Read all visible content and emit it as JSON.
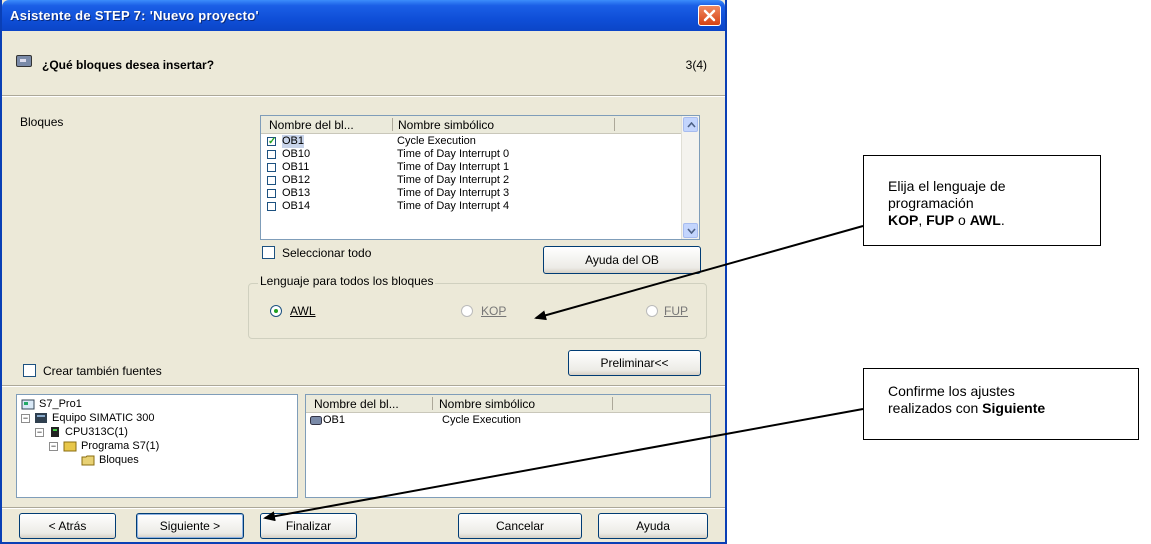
{
  "window": {
    "title": "Asistente de STEP 7: 'Nuevo proyecto'",
    "question": "¿Qué bloques desea insertar?",
    "step": "3(4)"
  },
  "blocks": {
    "label": "Bloques",
    "columns": [
      "Nombre del bl...",
      "Nombre simbólico"
    ],
    "rows": [
      {
        "name": "OB1",
        "symbol": "Cycle Execution",
        "checked": true
      },
      {
        "name": "OB10",
        "symbol": "Time of Day Interrupt 0",
        "checked": false
      },
      {
        "name": "OB11",
        "symbol": "Time of Day Interrupt 1",
        "checked": false
      },
      {
        "name": "OB12",
        "symbol": "Time of Day Interrupt 2",
        "checked": false
      },
      {
        "name": "OB13",
        "symbol": "Time of Day Interrupt 3",
        "checked": false
      },
      {
        "name": "OB14",
        "symbol": "Time of Day Interrupt 4",
        "checked": false
      }
    ],
    "select_all": "Seleccionar todo",
    "help_ob": "Ayuda del OB"
  },
  "language": {
    "group_label": "Lenguaje para todos los bloques",
    "options": [
      "AWL",
      "KOP",
      "FUP"
    ],
    "selected": "AWL"
  },
  "create_sources": "Crear también fuentes",
  "preview_button": "Preliminar<<",
  "preview": {
    "tree": [
      {
        "label": "S7_Pro1"
      },
      {
        "label": "Equipo SIMATIC 300"
      },
      {
        "label": "CPU313C(1)"
      },
      {
        "label": "Programa S7(1)"
      },
      {
        "label": "Bloques"
      }
    ],
    "columns": [
      "Nombre del bl...",
      "Nombre simbólico"
    ],
    "rows": [
      {
        "name": "OB1",
        "symbol": "Cycle Execution"
      }
    ]
  },
  "buttons": {
    "back": "< Atrás",
    "next": "Siguiente >",
    "finish": "Finalizar",
    "cancel": "Cancelar",
    "help": "Ayuda"
  },
  "callouts": {
    "language_line1": "Elija el lenguaje de",
    "language_line2": "programación",
    "language_kop": "KOP",
    "language_sep1": ", ",
    "language_fup": "FUP",
    "language_sep2": " o ",
    "language_awl": "AWL",
    "language_end": ".",
    "confirm_line1": "Confirme los ajustes",
    "confirm_line2": "realizados con ",
    "confirm_bold": "Siguiente"
  },
  "colors": {
    "titlebar": "#0b45c7",
    "dialog_bg": "#ece9d8",
    "close_button": "#d64214"
  }
}
